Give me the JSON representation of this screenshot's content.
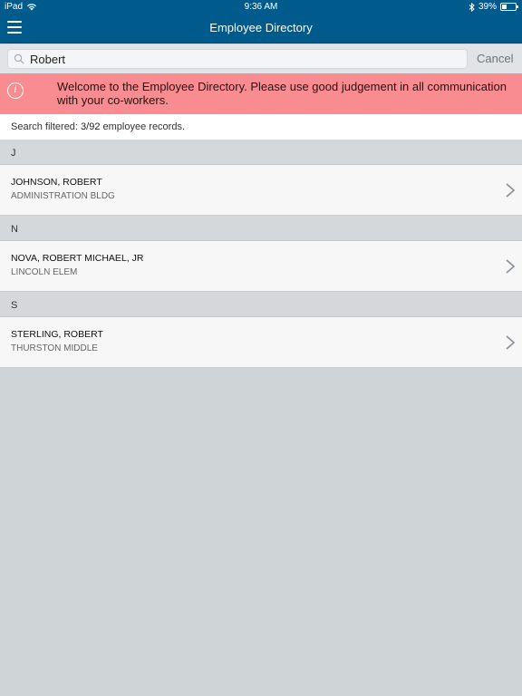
{
  "status_bar": {
    "device": "iPad",
    "time": "9:36 AM",
    "battery": "39%",
    "battery_level": 0.39
  },
  "nav": {
    "title": "Employee Directory"
  },
  "search": {
    "value": "Robert",
    "cancel_label": "Cancel"
  },
  "banner": {
    "text": "Welcome to the Employee Directory. Please use good judgement in all communication with your co-workers."
  },
  "filter": {
    "prefix": "Search filtered: ",
    "count": "3/92",
    "suffix": " employee records."
  },
  "sections": [
    {
      "letter": "J",
      "employees": [
        {
          "name": "JOHNSON, ROBERT",
          "location": "ADMINISTRATION BLDG"
        }
      ]
    },
    {
      "letter": "N",
      "employees": [
        {
          "name": "NOVA, ROBERT MICHAEL, JR",
          "location": "LINCOLN ELEM"
        }
      ]
    },
    {
      "letter": "S",
      "employees": [
        {
          "name": "STERLING, ROBERT",
          "location": "THURSTON MIDDLE"
        }
      ]
    }
  ],
  "colors": {
    "nav": "#005b8d",
    "banner": "#f88c90",
    "background": "#cfd4d7"
  },
  "icons": {
    "menu": "hamburger-icon",
    "search": "magnifier-icon",
    "info": "info-icon",
    "row": "chevron-right-icon"
  }
}
